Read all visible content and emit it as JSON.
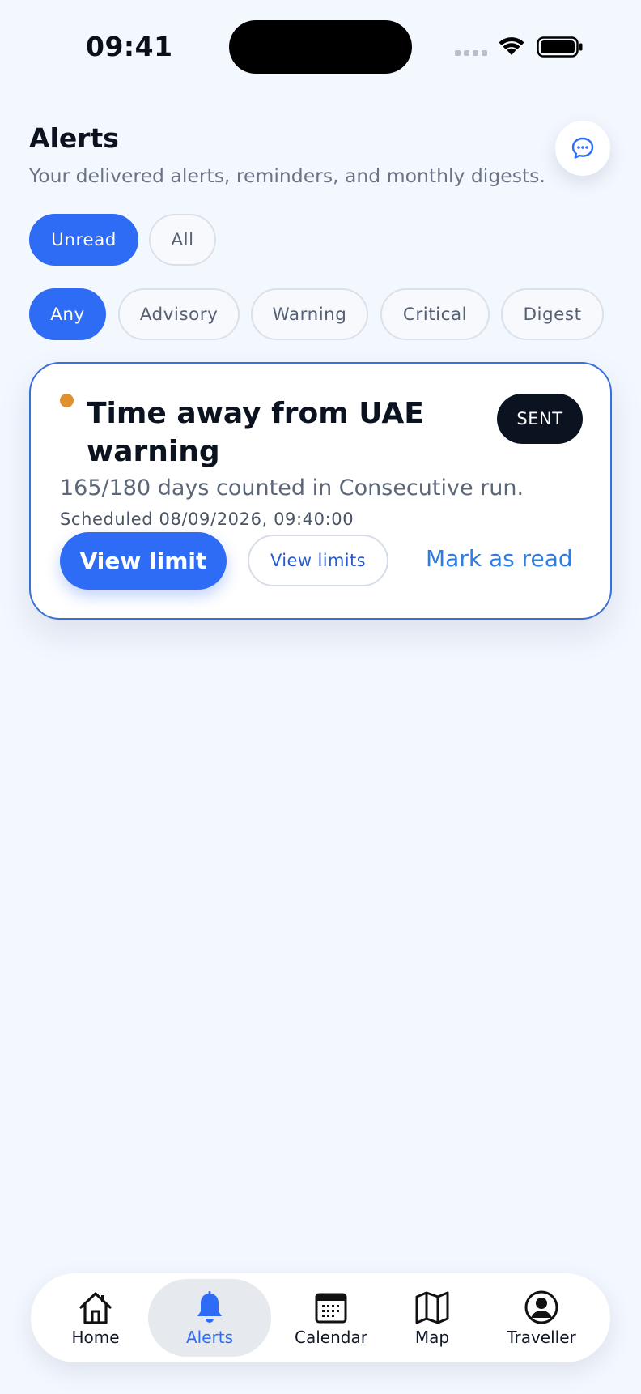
{
  "status_bar": {
    "time": "09:41"
  },
  "header": {
    "title": "Alerts",
    "subtitle": "Your delivered alerts, reminders, and monthly digests."
  },
  "read_filter": [
    {
      "label": "Unread",
      "active": true
    },
    {
      "label": "All",
      "active": false
    }
  ],
  "severity_filter": [
    {
      "label": "Any",
      "active": true
    },
    {
      "label": "Advisory",
      "active": false
    },
    {
      "label": "Warning",
      "active": false
    },
    {
      "label": "Critical",
      "active": false
    },
    {
      "label": "Digest",
      "active": false
    }
  ],
  "alert": {
    "severity_color": "#e0912f",
    "title": "Time away from UAE warning",
    "status": "SENT",
    "body": "165/180 days counted in Consecutive run.",
    "scheduled": "Scheduled 08/09/2026, 09:40:00",
    "primary_action": "View limit",
    "secondary_action": "View limits",
    "link_action": "Mark as read"
  },
  "bottom_nav": [
    {
      "label": "Home",
      "icon": "home-icon",
      "active": false
    },
    {
      "label": "Alerts",
      "icon": "bell-icon",
      "active": true
    },
    {
      "label": "Calendar",
      "icon": "calendar-icon",
      "active": false
    },
    {
      "label": "Map",
      "icon": "map-icon",
      "active": false
    },
    {
      "label": "Traveller",
      "icon": "person-icon",
      "active": false
    }
  ],
  "colors": {
    "accent": "#2f6cf6",
    "background": "#f3f7fe",
    "badge": "#0b1220"
  }
}
